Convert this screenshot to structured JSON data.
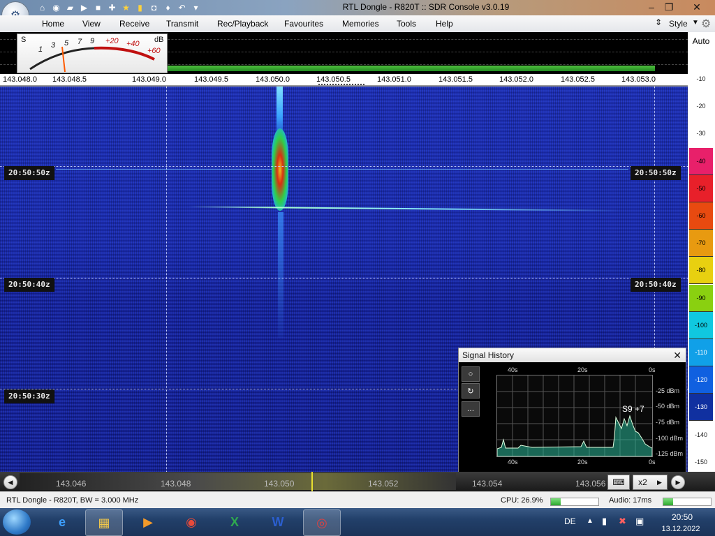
{
  "window": {
    "title": "RTL Dongle - R820T :: SDR Console v3.0.19"
  },
  "quick_access_icons": [
    "home-icon",
    "record-icon",
    "folder-icon",
    "play-icon",
    "stop-icon",
    "add-icon",
    "star-icon",
    "lock-icon",
    "camera-icon",
    "drop-icon",
    "undo-icon",
    "dropdown-icon"
  ],
  "menu": {
    "items": [
      "Home",
      "View",
      "Receive",
      "Transmit",
      "Rec/Playback",
      "Favourites",
      "Memories",
      "Tools",
      "Help"
    ],
    "style_label": "Style"
  },
  "smeter": {
    "labels": [
      "S",
      "1",
      "3",
      "5",
      "7",
      "9",
      "+20",
      "+40",
      "+60",
      "dB"
    ]
  },
  "frequency_scale": {
    "ticks": [
      "143.048.0",
      "143.048.5",
      "143.049.0",
      "143.049.5",
      "143.050.0",
      "143.050.5",
      "143.051.0",
      "143.051.5",
      "143.052.0",
      "143.052.5",
      "143.053.0"
    ]
  },
  "db_scale": {
    "auto_label": "Auto",
    "values": [
      "-10",
      "-20",
      "-30",
      "-40",
      "-50",
      "-60",
      "-70",
      "-80",
      "-90",
      "-100",
      "-110",
      "-120",
      "-130",
      "-140",
      "-150"
    ],
    "colors": [
      "#ffffff",
      "#ffffff",
      "#ffffff",
      "#e8206a",
      "#e8202a",
      "#e84a10",
      "#e89a10",
      "#e8d010",
      "#8ad010",
      "#10c8e0",
      "#10a0e8",
      "#1060e0",
      "#1030a0",
      "#ffffff",
      "#ffffff"
    ]
  },
  "waterfall": {
    "timestamps": [
      "20:50:50z",
      "20:50:40z",
      "20:50:30z"
    ]
  },
  "signal_history": {
    "title": "Signal History",
    "time_labels_top": [
      "40s",
      "20s",
      "0s"
    ],
    "time_labels_bottom": [
      "40s",
      "20s",
      "0s"
    ],
    "level_labels": [
      "-25 dBm",
      "-50 dBm",
      "-75 dBm",
      "-100 dBm",
      "-125 dBm"
    ],
    "current_level": "S9 +7"
  },
  "tuning_bar": {
    "frequencies": [
      "143.046",
      "143.048",
      "143.050",
      "143.052",
      "143.054",
      "143.056"
    ],
    "zoom_label": "x2"
  },
  "status": {
    "left": "RTL Dongle - R820T, BW = 3.000 MHz",
    "cpu": "CPU: 26.9%",
    "audio": "Audio: 17ms"
  },
  "taskbar": {
    "apps": [
      "internet-explorer-icon",
      "file-explorer-icon",
      "media-player-icon",
      "chrome-icon",
      "excel-icon",
      "word-icon",
      "sdr-console-icon"
    ],
    "language": "DE",
    "time": "20:50",
    "date": "13.12.2022"
  }
}
